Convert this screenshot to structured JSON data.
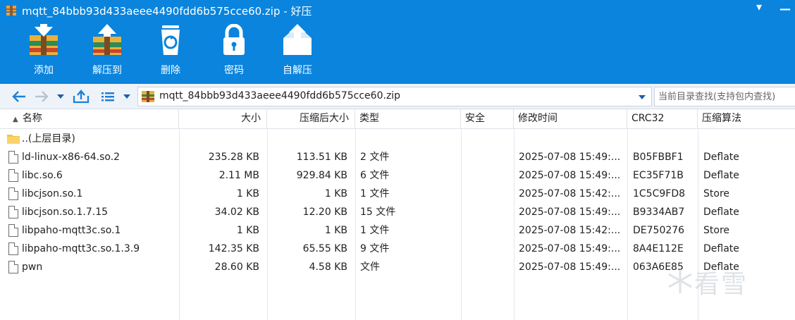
{
  "window": {
    "title": "mqtt_84bbb93d433aeee4490fdd6b575cce60.zip - 好压",
    "controls": {
      "menu": "▾",
      "minimize": "—"
    }
  },
  "toolbar": [
    {
      "id": "extract-add",
      "label": "添加",
      "icon": "add-archive-icon"
    },
    {
      "id": "extract-to",
      "label": "解压到",
      "icon": "extract-to-icon"
    },
    {
      "id": "delete",
      "label": "删除",
      "icon": "recycle-bin-icon"
    },
    {
      "id": "password",
      "label": "密码",
      "icon": "lock-icon"
    },
    {
      "id": "self-extract",
      "label": "自解压",
      "icon": "self-extract-icon"
    }
  ],
  "navbar": {
    "path": "mqtt_84bbb93d433aeee4490fdd6b575cce60.zip",
    "search_placeholder": "当前目录查找(支持包内查找)"
  },
  "columns": {
    "name": "名称",
    "size": "大小",
    "packed": "压缩后大小",
    "type": "类型",
    "security": "安全",
    "modified": "修改时间",
    "crc": "CRC32",
    "method": "压缩算法",
    "sort_indicator": "▲"
  },
  "parent_dir": "..(上层目录)",
  "files": [
    {
      "name": "ld-linux-x86-64.so.2",
      "size": "235.28 KB",
      "packed": "113.51 KB",
      "type": "2 文件",
      "modified": "2025-07-08 15:49:...",
      "crc": "B05FBBF1",
      "method": "Deflate"
    },
    {
      "name": "libc.so.6",
      "size": "2.11 MB",
      "packed": "929.84 KB",
      "type": "6 文件",
      "modified": "2025-07-08 15:49:...",
      "crc": "EC35F71B",
      "method": "Deflate"
    },
    {
      "name": "libcjson.so.1",
      "size": "1 KB",
      "packed": "1 KB",
      "type": "1 文件",
      "modified": "2025-07-08 15:42:...",
      "crc": "1C5C9FD8",
      "method": "Store"
    },
    {
      "name": "libcjson.so.1.7.15",
      "size": "34.02 KB",
      "packed": "12.20 KB",
      "type": "15 文件",
      "modified": "2025-07-08 15:49:...",
      "crc": "B9334AB7",
      "method": "Deflate"
    },
    {
      "name": "libpaho-mqtt3c.so.1",
      "size": "1 KB",
      "packed": "1 KB",
      "type": "1 文件",
      "modified": "2025-07-08 15:42:...",
      "crc": "DE750276",
      "method": "Store"
    },
    {
      "name": "libpaho-mqtt3c.so.1.3.9",
      "size": "142.35 KB",
      "packed": "65.55 KB",
      "type": "9 文件",
      "modified": "2025-07-08 15:49:...",
      "crc": "8A4E112E",
      "method": "Deflate"
    },
    {
      "name": "pwn",
      "size": "28.60 KB",
      "packed": "4.58 KB",
      "type": "文件",
      "modified": "2025-07-08 15:49:...",
      "crc": "063A6E85",
      "method": "Deflate"
    }
  ],
  "watermark": {
    "text": "看雪",
    "icon": "snowflake-icon"
  },
  "colors": {
    "accent": "#0a84dd",
    "navbar": "#eef3f9"
  }
}
